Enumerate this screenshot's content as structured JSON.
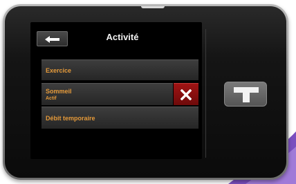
{
  "screen": {
    "title": "Activité",
    "back_icon": "left-arrow-icon"
  },
  "menu": {
    "items": [
      {
        "label": "Exercice"
      },
      {
        "label": "Sommeil",
        "status": "Actif",
        "action_icon": "close-x-icon"
      },
      {
        "label": "Débit temporaire"
      }
    ]
  },
  "device": {
    "home_button_icon": "t-logo-icon"
  },
  "colors": {
    "label": "#e59a3a",
    "title": "#f2f2f2",
    "stop": "#a01414",
    "background_wave": "#7a4fbf"
  }
}
